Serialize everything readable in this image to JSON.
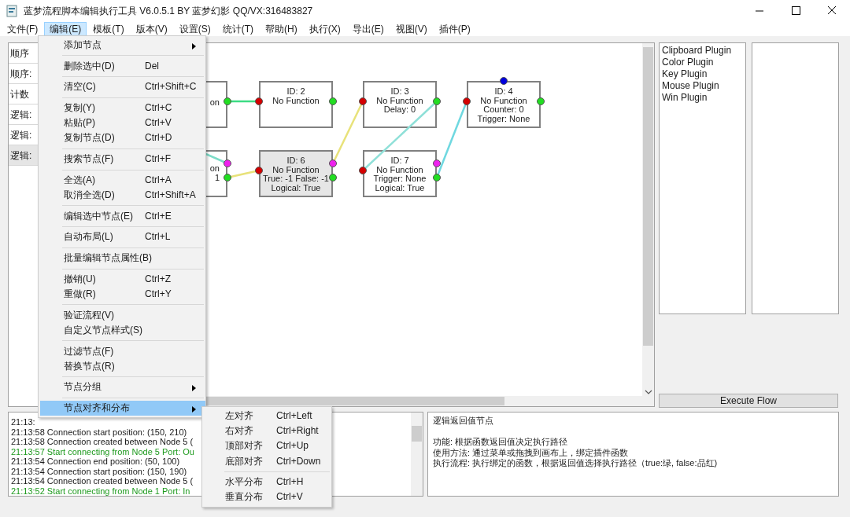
{
  "window": {
    "title": "蓝梦流程脚本编辑执行工具 V6.0.5.1 BY 蓝梦幻影 QQ/VX:316483827"
  },
  "menubar": [
    {
      "label": "文件(F)",
      "selected": false
    },
    {
      "label": "编辑(E)",
      "selected": true
    },
    {
      "label": "模板(T)",
      "selected": false
    },
    {
      "label": "版本(V)",
      "selected": false
    },
    {
      "label": "设置(S)",
      "selected": false
    },
    {
      "label": "统计(T)",
      "selected": false
    },
    {
      "label": "帮助(H)",
      "selected": false
    },
    {
      "label": "执行(X)",
      "selected": false
    },
    {
      "label": "导出(E)",
      "selected": false
    },
    {
      "label": "视图(V)",
      "selected": false
    },
    {
      "label": "插件(P)",
      "selected": false
    }
  ],
  "node_list": [
    {
      "label": "顺序",
      "selected": false
    },
    {
      "label": "顺序:",
      "selected": false
    },
    {
      "label": "计数",
      "selected": false
    },
    {
      "label": "逻辑:",
      "selected": false
    },
    {
      "label": "逻辑:",
      "selected": false
    },
    {
      "label": "逻辑:",
      "selected": true
    }
  ],
  "canvas": {
    "nodes": [
      {
        "kind": "partial",
        "lines": [
          "on"
        ],
        "selected": false
      },
      {
        "kind": "basic",
        "lines": [
          "ID: 2",
          "No Function"
        ],
        "selected": false
      },
      {
        "kind": "basic",
        "lines": [
          "ID: 3",
          "No Function",
          "Delay: 0"
        ],
        "selected": false
      },
      {
        "kind": "counter",
        "lines": [
          "ID: 4",
          "No Function",
          "Counter: 0",
          "Trigger: None"
        ],
        "selected": false
      },
      {
        "kind": "partial_logic",
        "lines": [
          "on",
          "1"
        ],
        "selected": false
      },
      {
        "kind": "logic",
        "lines": [
          "ID: 6",
          "No Function",
          "True: -1 False: -1",
          "Logical: True"
        ],
        "selected": true
      },
      {
        "kind": "logic",
        "lines": [
          "ID: 7",
          "No Function",
          "Trigger: None",
          "Logical: True"
        ],
        "selected": false
      }
    ],
    "connections": [
      {
        "color": "#3ddc84"
      },
      {
        "color": "#7ddcc8"
      },
      {
        "color": "#e8e27a"
      },
      {
        "color": "#e8e27a"
      },
      {
        "color": "#8fe0d8"
      },
      {
        "color": "#6fd8e0"
      }
    ]
  },
  "edit_menu": [
    {
      "kind": "submenu",
      "label": "添加节点",
      "selected": false
    },
    {
      "kind": "separator"
    },
    {
      "kind": "item",
      "label": "删除选中(D)",
      "shortcut": "Del"
    },
    {
      "kind": "separator"
    },
    {
      "kind": "item",
      "label": "清空(C)",
      "shortcut": "Ctrl+Shift+C"
    },
    {
      "kind": "separator"
    },
    {
      "kind": "item",
      "label": "复制(Y)",
      "shortcut": "Ctrl+C"
    },
    {
      "kind": "item",
      "label": "粘贴(P)",
      "shortcut": "Ctrl+V"
    },
    {
      "kind": "item",
      "label": "复制节点(D)",
      "shortcut": "Ctrl+D"
    },
    {
      "kind": "separator"
    },
    {
      "kind": "item",
      "label": "搜索节点(F)",
      "shortcut": "Ctrl+F"
    },
    {
      "kind": "separator"
    },
    {
      "kind": "item",
      "label": "全选(A)",
      "shortcut": "Ctrl+A"
    },
    {
      "kind": "item",
      "label": "取消全选(D)",
      "shortcut": "Ctrl+Shift+A"
    },
    {
      "kind": "separator"
    },
    {
      "kind": "item",
      "label": "编辑选中节点(E)",
      "shortcut": "Ctrl+E"
    },
    {
      "kind": "separator"
    },
    {
      "kind": "item",
      "label": "自动布局(L)",
      "shortcut": "Ctrl+L"
    },
    {
      "kind": "separator"
    },
    {
      "kind": "item",
      "label": "批量编辑节点属性(B)"
    },
    {
      "kind": "separator"
    },
    {
      "kind": "item",
      "label": "撤销(U)",
      "shortcut": "Ctrl+Z"
    },
    {
      "kind": "item",
      "label": "重做(R)",
      "shortcut": "Ctrl+Y"
    },
    {
      "kind": "separator"
    },
    {
      "kind": "item",
      "label": "验证流程(V)"
    },
    {
      "kind": "item",
      "label": "自定义节点样式(S)"
    },
    {
      "kind": "separator"
    },
    {
      "kind": "item",
      "label": "过滤节点(F)"
    },
    {
      "kind": "item",
      "label": "替换节点(R)"
    },
    {
      "kind": "separator"
    },
    {
      "kind": "submenu",
      "label": "节点分组",
      "selected": false
    },
    {
      "kind": "separator"
    },
    {
      "kind": "submenu",
      "label": "节点对齐和分布",
      "selected": true
    }
  ],
  "align_submenu": [
    {
      "kind": "item",
      "label": "左对齐",
      "shortcut": "Ctrl+Left"
    },
    {
      "kind": "item",
      "label": "右对齐",
      "shortcut": "Ctrl+Right"
    },
    {
      "kind": "item",
      "label": "顶部对齐",
      "shortcut": "Ctrl+Up"
    },
    {
      "kind": "item",
      "label": "底部对齐",
      "shortcut": "Ctrl+Down"
    },
    {
      "kind": "separator"
    },
    {
      "kind": "item",
      "label": "水平分布",
      "shortcut": "Ctrl+H"
    },
    {
      "kind": "item",
      "label": "垂直分布",
      "shortcut": "Ctrl+V"
    }
  ],
  "plugins": [
    "Clipboard Plugin",
    "Color Plugin",
    "Key Plugin",
    "Mouse Plugin",
    "Win Plugin"
  ],
  "execute_button": "Execute Flow",
  "log": [
    {
      "text": "21:13:",
      "kind": "info"
    },
    {
      "text": "21:13:58 Connection start position: (150, 210)",
      "kind": "info"
    },
    {
      "text": "21:13:58 Connection created between Node 5 (",
      "kind": "info"
    },
    {
      "text": "21:13:57 Start connecting from Node 5 Port: Ou",
      "kind": "start"
    },
    {
      "text": "21:13:54 Connection end position: (50, 100)",
      "kind": "info"
    },
    {
      "text": "21:13:54 Connection start position: (150, 190)",
      "kind": "info"
    },
    {
      "text": "21:13:54 Connection created between Node 5 (",
      "kind": "info"
    },
    {
      "text": "21:13:52 Start connecting from Node 1 Port: In",
      "kind": "start"
    }
  ],
  "info": {
    "title": "逻辑返回值节点",
    "lines": [
      "功能: 根据函数返回值决定执行路径",
      "使用方法: 通过菜单或拖拽到画布上，绑定插件函数",
      "执行流程: 执行绑定的函数，根据返回值选择执行路径（true:绿, false:品红)"
    ]
  }
}
